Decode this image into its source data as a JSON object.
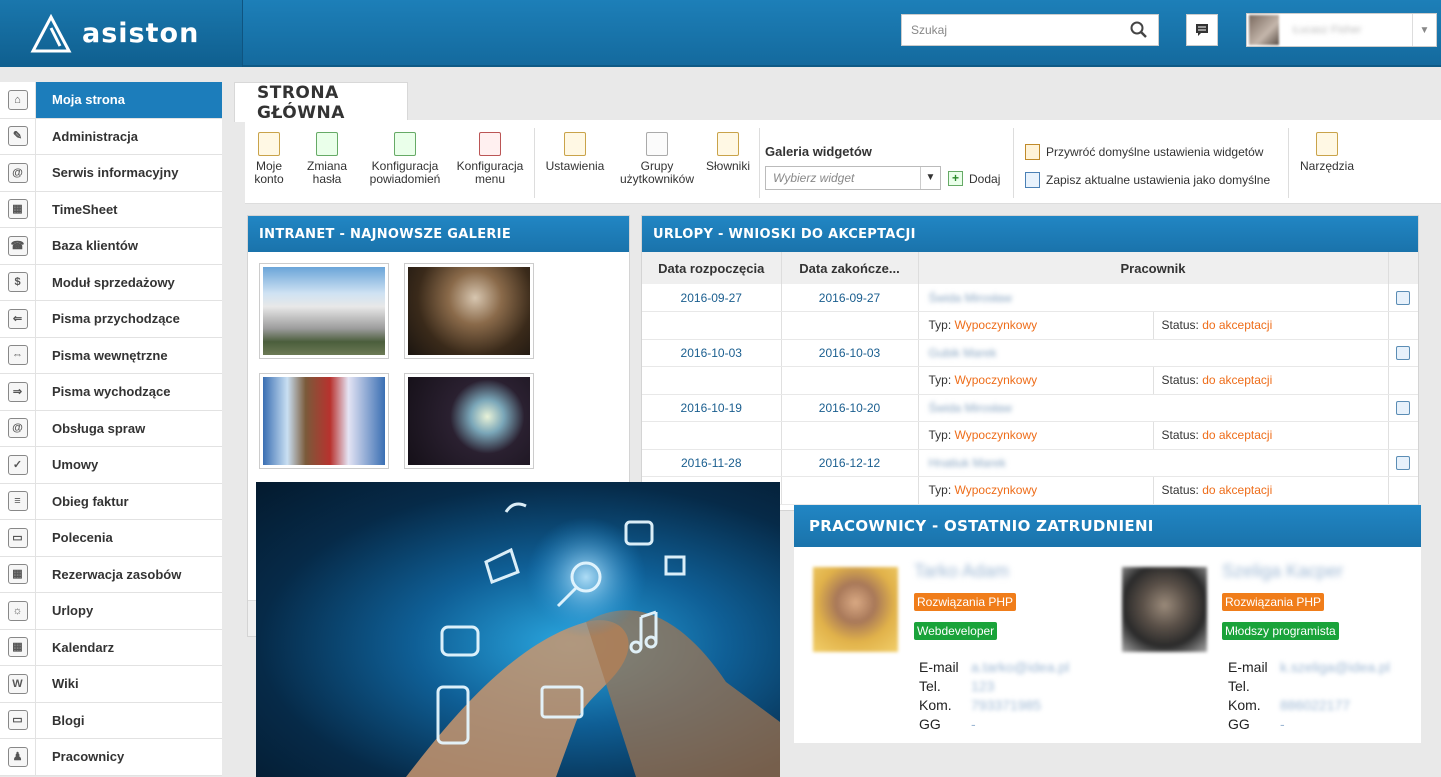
{
  "header": {
    "brand": "asiston",
    "search_placeholder": "Szukaj",
    "user_name": "Łucasz Fisher"
  },
  "sidebar": {
    "items": [
      {
        "label": "Moja strona",
        "icon": "home-icon",
        "active": true
      },
      {
        "label": "Administracja",
        "icon": "pencil-icon"
      },
      {
        "label": "Serwis informacyjny",
        "icon": "at-icon"
      },
      {
        "label": "TimeSheet",
        "icon": "calendar-icon"
      },
      {
        "label": "Baza klientów",
        "icon": "phone-icon"
      },
      {
        "label": "Moduł sprzedażowy",
        "icon": "money-icon"
      },
      {
        "label": "Pisma przychodzące",
        "icon": "document-in-icon"
      },
      {
        "label": "Pisma wewnętrzne",
        "icon": "document-internal-icon"
      },
      {
        "label": "Pisma wychodzące",
        "icon": "document-out-icon"
      },
      {
        "label": "Obsługa spraw",
        "icon": "at-icon"
      },
      {
        "label": "Umowy",
        "icon": "contract-icon"
      },
      {
        "label": "Obieg faktur",
        "icon": "invoice-icon"
      },
      {
        "label": "Polecenia",
        "icon": "speech-bubble-icon"
      },
      {
        "label": "Rezerwacja zasobów",
        "icon": "calendar-icon"
      },
      {
        "label": "Urlopy",
        "icon": "vacation-icon"
      },
      {
        "label": "Kalendarz",
        "icon": "calendar-icon"
      },
      {
        "label": "Wiki",
        "icon": "wiki-icon"
      },
      {
        "label": "Blogi",
        "icon": "speech-bubble-icon"
      },
      {
        "label": "Pracownicy",
        "icon": "person-icon"
      }
    ]
  },
  "tab": {
    "title": "STRONA GŁÓWNA"
  },
  "toolbar": {
    "moje_konto": [
      "Moje",
      "konto"
    ],
    "zmiana_hasla": [
      "Zmiana",
      "hasła"
    ],
    "konf_powiadomien": [
      "Konfiguracja",
      "powiadomień"
    ],
    "konf_menu": [
      "Konfiguracja",
      "menu"
    ],
    "ustawienia": "Ustawienia",
    "grupy": [
      "Grupy",
      "użytkowników"
    ],
    "slowniki": "Słowniki",
    "galeria_title": "Galeria widgetów",
    "galeria_placeholder": "Wybierz widget",
    "dodaj": "Dodaj",
    "przywroc": "Przywróć domyślne ustawienia widgetów",
    "zapisz": "Zapisz aktualne ustawienia jako domyślne",
    "narzedzia": "Narzędzia"
  },
  "gallery_panel": {
    "title": "INTRANET - NAJNOWSZE GALERIE"
  },
  "leave_panel": {
    "title": "URLOPY - WNIOSKI DO AKCEPTACJI",
    "col_start": "Data rozpoczęcia",
    "col_end": "Data zakończe...",
    "col_employee": "Pracownik",
    "type_label": "Typ:",
    "status_label": "Status:",
    "rows": [
      {
        "start": "2016-09-27",
        "end": "2016-09-27",
        "employee": "Świda Mirosław",
        "type": "Wypoczynkowy",
        "status": "do akceptacji"
      },
      {
        "start": "2016-10-03",
        "end": "2016-10-03",
        "employee": "Gubik Marek",
        "type": "Wypoczynkowy",
        "status": "do akceptacji"
      },
      {
        "start": "2016-10-19",
        "end": "2016-10-20",
        "employee": "Świda Mirosław",
        "type": "Wypoczynkowy",
        "status": "do akceptacji"
      },
      {
        "start": "2016-11-28",
        "end": "2016-12-12",
        "employee": "Hnatiuk Marek",
        "type": "Wypoczynkowy",
        "status": "do akceptacji"
      }
    ]
  },
  "employees_panel": {
    "title": "PRACOWNICY - OSTATNIO ZATRUDNIENI",
    "labels": {
      "email": "E-mail",
      "tel": "Tel.",
      "kom": "Kom.",
      "gg": "GG"
    },
    "people": [
      {
        "name": "Tarko Adam",
        "dept": "Rozwiązania PHP",
        "role": "Webdeveloper",
        "email": "a.tarko@idea.pl",
        "tel": "123",
        "kom": "793371985",
        "gg": "-"
      },
      {
        "name": "Szeliga Kacper",
        "dept": "Rozwiązania PHP",
        "role": "Młodszy programista",
        "email": "k.szeliga@idea.pl",
        "tel": "",
        "kom": "886022177",
        "gg": "-"
      }
    ]
  },
  "colors": {
    "accent": "#1c7dbb",
    "orange": "#f07d1a",
    "green": "#1aa33a"
  }
}
